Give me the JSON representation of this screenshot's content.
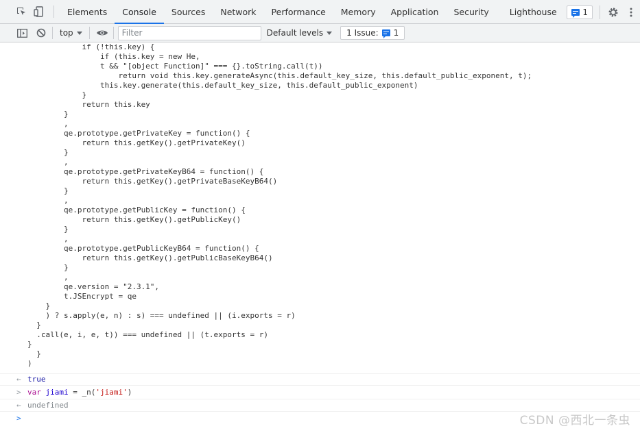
{
  "tabs": [
    "Elements",
    "Console",
    "Sources",
    "Network",
    "Performance",
    "Memory",
    "Application",
    "Security",
    "Lighthouse"
  ],
  "active_tab": "Console",
  "header": {
    "issues_badge_count": "1"
  },
  "toolbar": {
    "context": "top",
    "filter_placeholder": "Filter",
    "levels_label": "Default levels",
    "issues_label": "1 Issue:",
    "issues_count": "1"
  },
  "code_lines": [
    "            if (!this.key) {",
    "                if (this.key = new He,",
    "                t && \"[object Function]\" === {}.toString.call(t))",
    "                    return void this.key.generateAsync(this.default_key_size, this.default_public_exponent, t);",
    "                this.key.generate(this.default_key_size, this.default_public_exponent)",
    "            }",
    "            return this.key",
    "        }",
    "        ,",
    "        qe.prototype.getPrivateKey = function() {",
    "            return this.getKey().getPrivateKey()",
    "        }",
    "        ,",
    "        qe.prototype.getPrivateKeyB64 = function() {",
    "            return this.getKey().getPrivateBaseKeyB64()",
    "        }",
    "        ,",
    "        qe.prototype.getPublicKey = function() {",
    "            return this.getKey().getPublicKey()",
    "        }",
    "        ,",
    "        qe.prototype.getPublicKeyB64 = function() {",
    "            return this.getKey().getPublicBaseKeyB64()",
    "        }",
    "        ,",
    "        qe.version = \"2.3.1\",",
    "        t.JSEncrypt = qe",
    "    }",
    "    ) ? s.apply(e, n) : s) === undefined || (i.exports = r)",
    "  }",
    "  .call(e, i, e, t)) === undefined || (t.exports = r)",
    "}",
    "  }",
    ")"
  ],
  "results": {
    "return_symbol": "←",
    "input_symbol": ">",
    "true_value": "true",
    "input_keyword": "var",
    "input_identifier": "jiami",
    "input_middle": " = _n(",
    "input_string": "'jiami'",
    "input_end": ")",
    "undefined_value": "undefined"
  },
  "watermark": "CSDN @西北一条虫"
}
